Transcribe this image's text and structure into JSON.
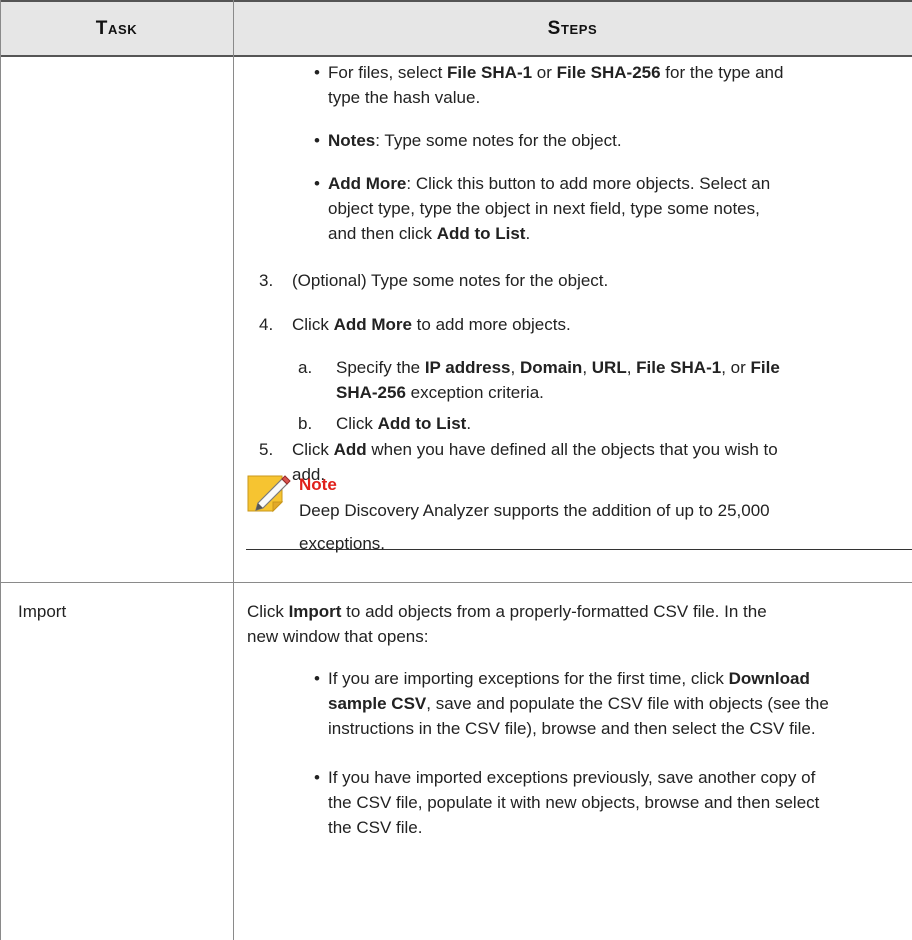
{
  "table": {
    "header": {
      "task": "Task",
      "steps": "Steps"
    }
  },
  "row_add": {
    "bullets": [
      {
        "lines": [
          [
            [
              "For files, select ",
              false
            ],
            [
              "File SHA-1",
              true
            ],
            [
              " or ",
              false
            ],
            [
              "File SHA-256",
              true
            ],
            [
              " for the type and",
              false
            ]
          ],
          [
            [
              "type the hash value.",
              false
            ]
          ]
        ]
      },
      {
        "lines": [
          [
            [
              "Notes",
              true
            ],
            [
              ": Type some notes for the object.",
              false
            ]
          ]
        ]
      },
      {
        "lines": [
          [
            [
              "Add More",
              true
            ],
            [
              ": Click this button to add more objects. Select an",
              false
            ]
          ],
          [
            [
              "object type, type the object in next field, type some notes,",
              false
            ]
          ],
          [
            [
              "and then click ",
              false
            ],
            [
              "Add to List",
              true
            ],
            [
              ".",
              false
            ]
          ]
        ]
      }
    ],
    "steps": [
      {
        "number": "3.",
        "lines": [
          [
            [
              "(Optional) Type some notes for the object.",
              false
            ]
          ]
        ]
      },
      {
        "number": "4.",
        "lines": [
          [
            [
              "Click ",
              false
            ],
            [
              "Add More",
              true
            ],
            [
              " to add more objects.",
              false
            ]
          ]
        ]
      },
      {
        "number": "5.",
        "lines": [
          [
            [
              "Click ",
              false
            ],
            [
              "Add",
              true
            ],
            [
              " when you have defined all the objects that you wish to",
              false
            ]
          ],
          [
            [
              "add.",
              false
            ]
          ]
        ]
      }
    ],
    "substeps": [
      {
        "letter": "a.",
        "lines": [
          [
            [
              "Specify the ",
              false
            ],
            [
              "IP address",
              true
            ],
            [
              ", ",
              false
            ],
            [
              "Domain",
              true
            ],
            [
              ", ",
              false
            ],
            [
              "URL",
              true
            ],
            [
              ", ",
              false
            ],
            [
              "File SHA-1",
              true
            ],
            [
              ", or ",
              false
            ],
            [
              "File",
              true
            ]
          ],
          [
            [
              "SHA-256",
              true
            ],
            [
              " exception criteria.",
              false
            ]
          ]
        ]
      },
      {
        "letter": "b.",
        "lines": [
          [
            [
              "Click ",
              false
            ],
            [
              "Add to List",
              true
            ],
            [
              ".",
              false
            ]
          ]
        ]
      }
    ],
    "note": {
      "title": "Note",
      "lines": [
        "Deep Discovery Analyzer supports the addition of up to 25,000",
        "exceptions."
      ]
    }
  },
  "row_import": {
    "task": "Import",
    "intro_lines": [
      [
        [
          "Click ",
          false
        ],
        [
          "Import",
          true
        ],
        [
          " to add objects from a properly-formatted CSV file. In the",
          false
        ]
      ],
      [
        [
          "new window that opens:",
          false
        ]
      ]
    ],
    "bullets": [
      {
        "lines": [
          [
            [
              "If you are importing exceptions for the first time, click ",
              false
            ],
            [
              "Download",
              true
            ]
          ],
          [
            [
              "sample CSV",
              true
            ],
            [
              ", save and populate the CSV file with objects (see the",
              false
            ]
          ],
          [
            [
              "instructions in the CSV file), browse and then select the CSV file.",
              false
            ]
          ]
        ]
      },
      {
        "lines": [
          [
            [
              "If you have imported exceptions previously, save another copy of",
              false
            ]
          ],
          [
            [
              "the CSV file, populate it with new objects, browse and then select",
              false
            ]
          ],
          [
            [
              "the CSV file.",
              false
            ]
          ]
        ]
      }
    ]
  }
}
